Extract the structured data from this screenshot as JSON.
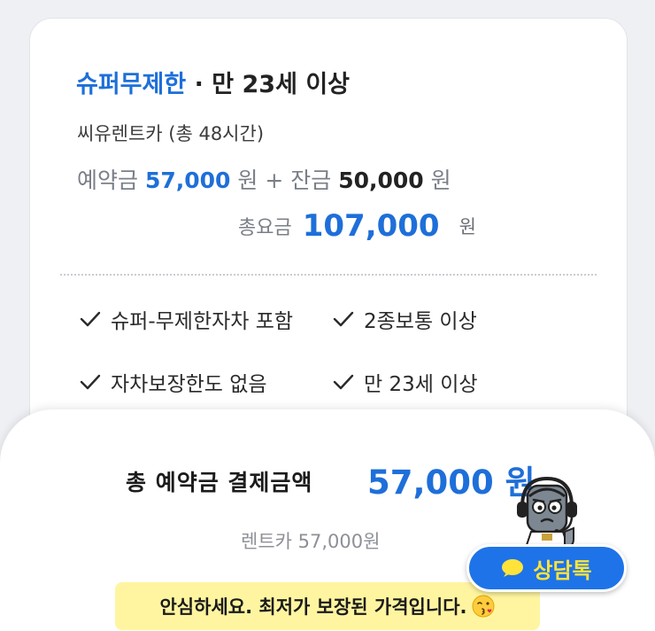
{
  "plan": {
    "name": "슈퍼무제한",
    "separator": " · ",
    "age": "만 23세 이상",
    "provider": "씨유렌트카 (총 48시간)"
  },
  "pricing": {
    "deposit_label": "예약금 ",
    "deposit_amount": "57,000",
    "deposit_unit": " 원 + ",
    "balance_label": "잔금 ",
    "balance_amount": "50,000",
    "balance_unit": " 원",
    "total_label": "총요금",
    "total_amount": "107,000",
    "total_unit": "원"
  },
  "features": [
    {
      "label": "슈퍼-무제한자차 포함"
    },
    {
      "label": "2종보통 이상"
    },
    {
      "label": "자차보장한도 없음"
    },
    {
      "label": "만 23세 이상"
    }
  ],
  "payment": {
    "label": "총 예약금 결제금액",
    "amount": "57,000 원",
    "breakdown": "렌트카 57,000원"
  },
  "notice": {
    "text": "안심하세요. 최저가 보장된 가격입니다.",
    "emoji_icon": "kissing-face-icon"
  },
  "chat_button": {
    "label": "상담톡",
    "icon": "chat-bubble-icon",
    "mascot_icon": "headset-agent-mascot-icon"
  },
  "colors": {
    "accent": "#1e6fd9",
    "chat_button_bg": "#1e73e8",
    "chat_button_text": "#ffe33b",
    "notice_bg": "#fff5a0"
  }
}
